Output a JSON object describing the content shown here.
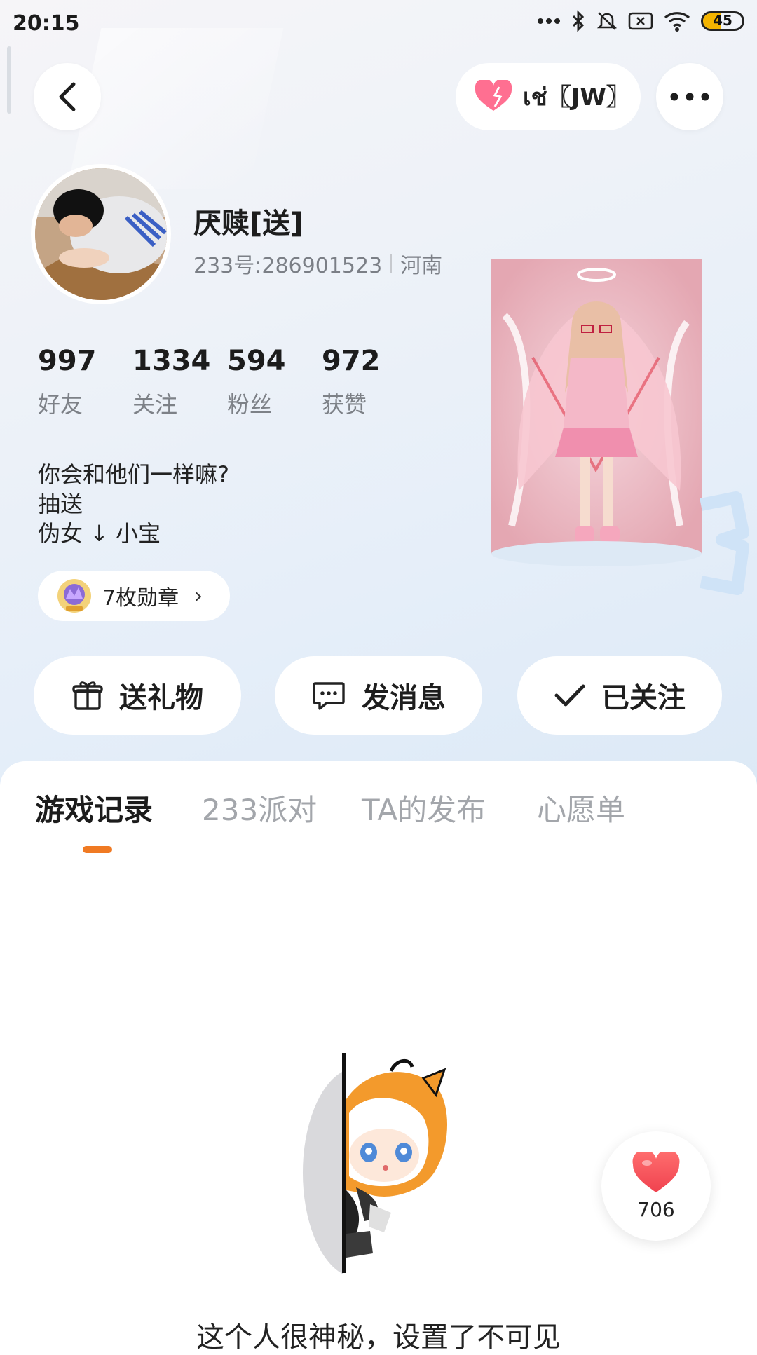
{
  "status_bar": {
    "time": "20:15",
    "battery": "45",
    "battery_level_percent": 45
  },
  "header": {
    "relation_tag": "เช่〖JW〗"
  },
  "profile": {
    "name": "厌赎[送]",
    "id_text": "233号:286901523",
    "region": "河南",
    "stats": [
      {
        "value": "997",
        "label": "好友"
      },
      {
        "value": "1334",
        "label": "关注"
      },
      {
        "value": "594",
        "label": "粉丝"
      },
      {
        "value": "972",
        "label": "获赞"
      }
    ],
    "bio_lines": [
      "你会和他们一样嘛?",
      "抽送",
      "伪女 ↓ 小宝"
    ],
    "badges_label": "7枚勋章"
  },
  "actions": {
    "gift": "送礼物",
    "message": "发消息",
    "follow": "已关注"
  },
  "tabs": [
    {
      "label": "游戏记录",
      "active": true
    },
    {
      "label": "233派对",
      "active": false
    },
    {
      "label": "TA的发布",
      "active": false
    },
    {
      "label": "心愿单",
      "active": false
    }
  ],
  "empty_state": {
    "text": "这个人很神秘，设置了不可见"
  },
  "like_fab": {
    "count": "706"
  },
  "colors": {
    "accent": "#f07a23",
    "heart": "#f0424f",
    "pink": "#ff6f91",
    "battery": "#f4b400"
  }
}
